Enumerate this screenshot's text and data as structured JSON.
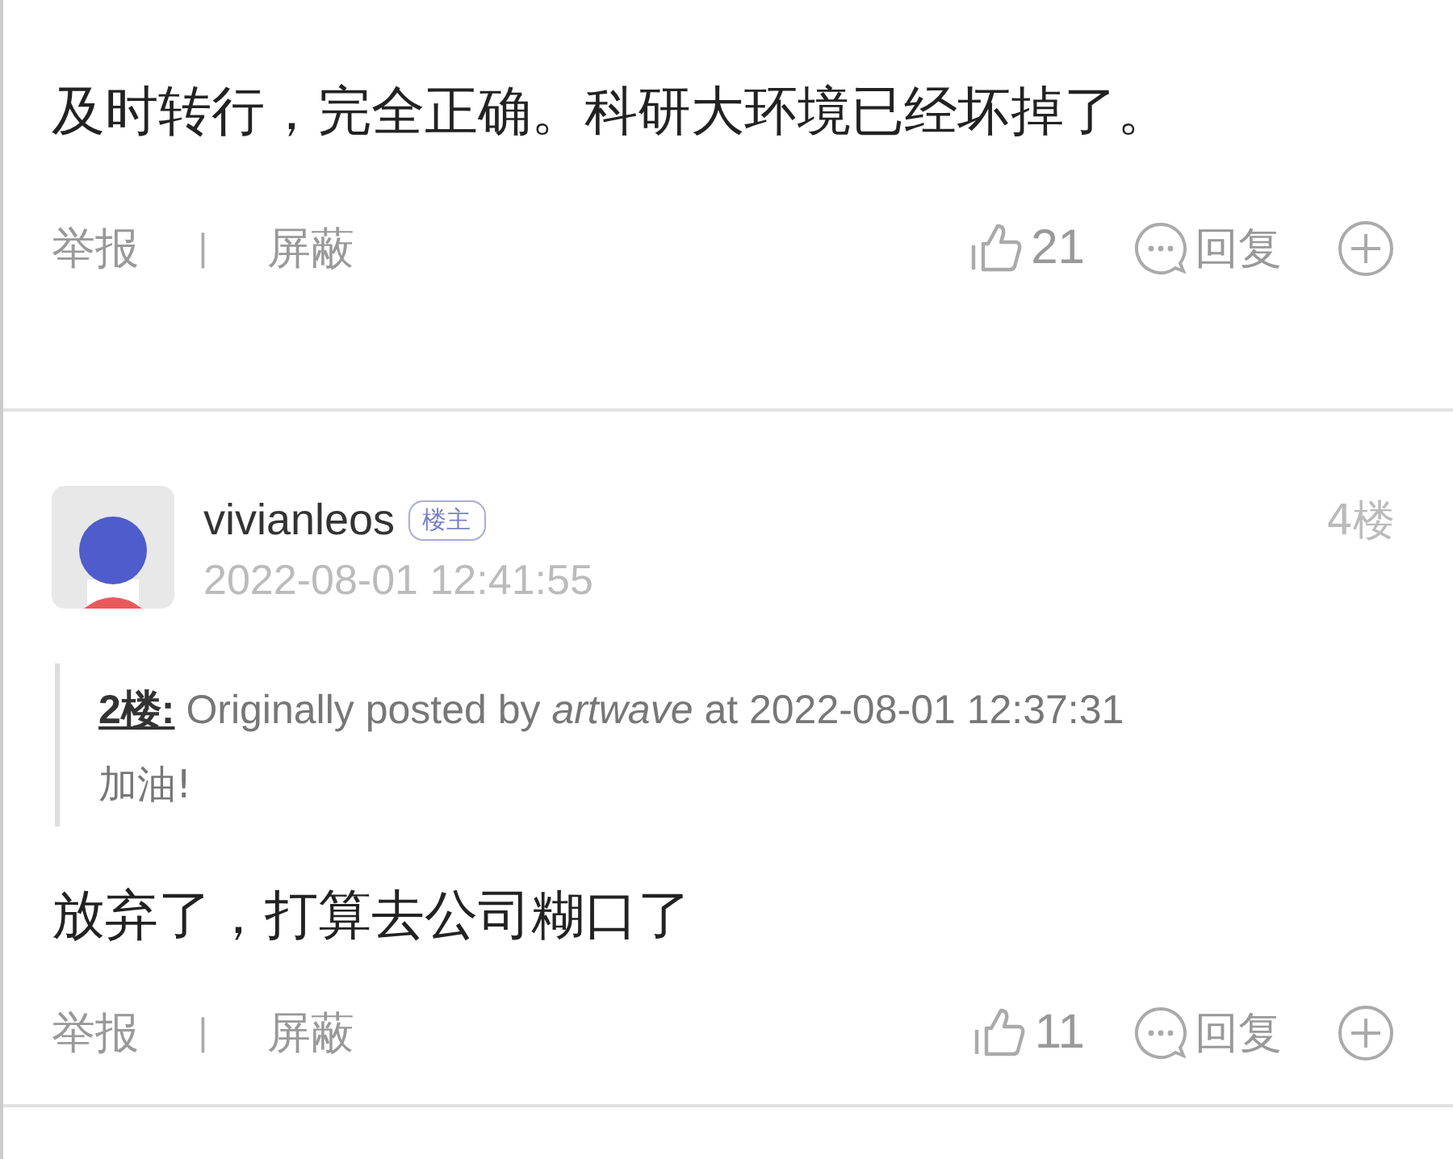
{
  "posts": [
    {
      "body": "及时转行，完全正确。科研大环境已经坏掉了。",
      "actions": {
        "report": "举报",
        "separator": "|",
        "block": "屏蔽",
        "likes": "21",
        "reply": "回复"
      }
    },
    {
      "author": {
        "name": "vivianleos",
        "badge": "楼主",
        "time": "2022-08-01 12:41:55"
      },
      "floor": "4楼",
      "quote": {
        "ref": "2楼:",
        "header": "Originally posted by *artwave* at 2022-08-01 12:37:31",
        "text": "加油!"
      },
      "body": "放弃了，打算去公司糊口了",
      "actions": {
        "report": "举报",
        "separator": "|",
        "block": "屏蔽",
        "likes": "11",
        "reply": "回复"
      }
    }
  ]
}
